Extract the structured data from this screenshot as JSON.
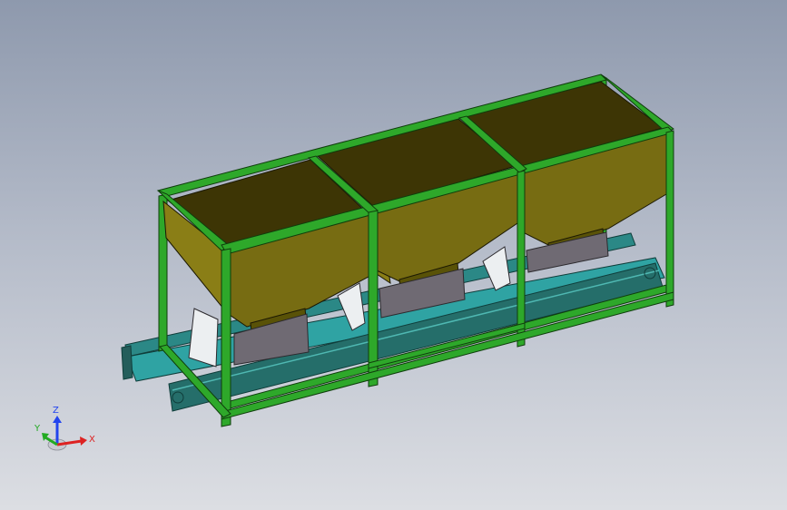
{
  "view": {
    "background_top": "#8e99ad",
    "background_bottom": "#dcdee3"
  },
  "model": {
    "hopper_count": 3,
    "frame_color": "#2ea82a",
    "frame_edge_color": "#0f3d0c",
    "hopper_outer_color": "#7f7414",
    "hopper_inner_color": "#3d3505",
    "hopper_rim_color": "#b3a92e",
    "conveyor_belt_color": "#2fa3a3",
    "conveyor_side_color": "#256e6a",
    "chute_color": "#6f6a73",
    "deflector_color": "#eceff1"
  },
  "triad": {
    "z_label": "Z",
    "y_label": "Y",
    "x_label": "X",
    "z_color": "#2244ee",
    "y_color": "#22aa22",
    "x_color": "#dd2222",
    "icons": [
      "axis-z-arrow-icon",
      "axis-y-arrow-icon",
      "axis-x-arrow-icon"
    ]
  }
}
